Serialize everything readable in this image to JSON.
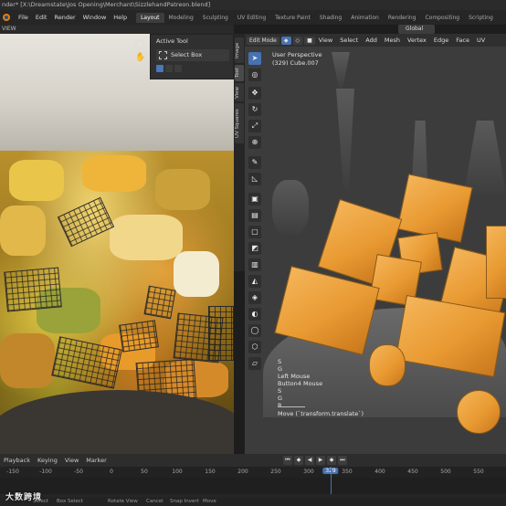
{
  "window": {
    "title": "nder* [X:\\Dreamstate\\Jos Opening\\Merchant\\SizzlehandPatreon.blend]"
  },
  "menu": {
    "items": [
      "File",
      "Edit",
      "Render",
      "Window",
      "Help"
    ]
  },
  "workspaces": [
    "Layout",
    "Modeling",
    "Sculpting",
    "UV Editing",
    "Texture Paint",
    "Shading",
    "Animation",
    "Rendering",
    "Compositing",
    "Scripting"
  ],
  "left_panel": {
    "header": "VIEW"
  },
  "tool_panel": {
    "title": "Active Tool",
    "tool_name": "Select Box"
  },
  "vertical_tabs": [
    "Image",
    "Tool",
    "View",
    "UV Squares"
  ],
  "viewport": {
    "mode": "Edit Mode",
    "menus": [
      "View",
      "Select",
      "Add",
      "Mesh",
      "Vertex",
      "Edge",
      "Face",
      "UV"
    ],
    "orientation": "Global",
    "perspective": "User Perspective",
    "object": "(329) Cube.007"
  },
  "key_overlay": [
    "S",
    "G",
    "Left Mouse",
    "Button4 Mouse",
    "S",
    "G",
    "R"
  ],
  "operator": "Move (`transform.translate`)",
  "timeline": {
    "menus": [
      "Playback",
      "Keying",
      "View",
      "Marker"
    ],
    "ticks": [
      "-150",
      "-100",
      "-50",
      "0",
      "50",
      "100",
      "150",
      "200",
      "250",
      "300",
      "350",
      "400",
      "450",
      "500",
      "550"
    ],
    "current_frame": "329"
  },
  "status": [
    "Select",
    "Box Select",
    "Rotate View",
    "Cancel",
    "Snap Invert",
    "Move"
  ],
  "watermark": "大数跨境",
  "colors": {
    "accent": "#4772b3",
    "cube": "#e99a32",
    "background": "#1d1d1d"
  }
}
